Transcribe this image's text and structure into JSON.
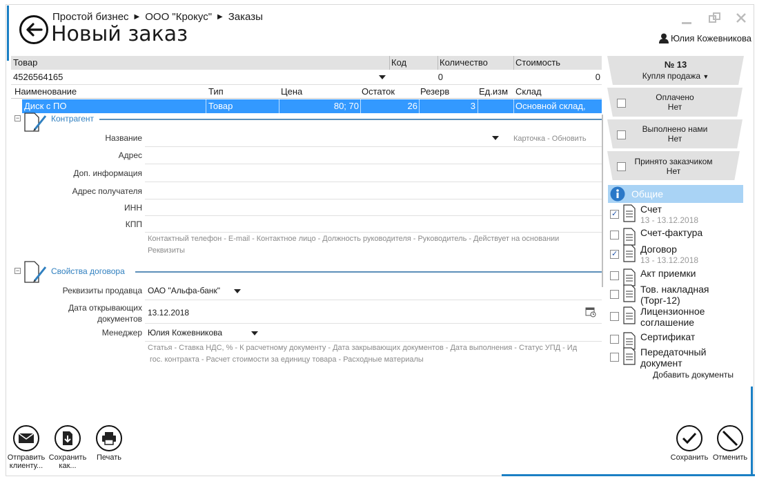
{
  "breadcrumb": [
    "Простой бизнес",
    "ООО \"Крокус\"",
    "Заказы"
  ],
  "title": "Новый заказ",
  "user": "Юлия Кожевникова",
  "goods_grid": {
    "headers": {
      "product": "Товар",
      "code": "Код",
      "qty": "Количество",
      "cost": "Стоимость"
    },
    "input": {
      "product": "4526564165",
      "qty": "0",
      "cost": "0"
    },
    "sub_headers": [
      "Наименование",
      "Тип",
      "Цена",
      "Остаток",
      "Резерв",
      "Ед.изм",
      "Склад"
    ],
    "selected_row": {
      "name": "Диск с ПО",
      "type": "Товар",
      "price": "80; 70",
      "stock": "26",
      "reserve": "3",
      "unit": "",
      "warehouse": "Основной склад,"
    }
  },
  "counterparty": {
    "section_title": "Контрагент",
    "labels": [
      "Название",
      "Адрес",
      "Доп. информация",
      "Адрес получателя",
      "ИНН",
      "КПП"
    ],
    "card_link": "Карточка",
    "refresh_link": "Обновить",
    "extra_links_1": [
      "Контактный телефон",
      "E-mail",
      "Контактное лицо",
      "Должность руководителя",
      "Руководитель",
      "Действует на основании"
    ],
    "extra_links_2": [
      "Реквизиты"
    ]
  },
  "contract": {
    "section_title": "Свойства договора",
    "seller_label": "Реквизиты продавца",
    "seller_value": "ОАО \"Альфа-банк\"",
    "date_label_1": "Дата открывающих",
    "date_label_2": "документов",
    "date_value": "13.12.2018",
    "manager_label": "Менеджер",
    "manager_value": "Юлия Кожевникова",
    "extra_links_1": [
      "Статья",
      "Ставка НДС, %",
      "К расчетному документу",
      "Дата закрывающих документов",
      "Дата выполнения",
      "Статус УПД",
      "Ид"
    ],
    "extra_links_2": [
      "гос. контракта",
      "Расчет стоимости за единицу товара",
      "Расходные материалы"
    ]
  },
  "order_panel": {
    "number": "№ 13",
    "type": "Купля продажа",
    "paid_label": "Оплачено",
    "paid_value": "Нет",
    "done_label": "Выполнено нами",
    "done_value": "Нет",
    "accepted_label": "Принято заказчиком",
    "accepted_value": "Нет"
  },
  "documents": {
    "header": "Общие",
    "items": [
      {
        "label": "Счет",
        "sub": "13 - 13.12.2018",
        "checked": true
      },
      {
        "label": "Счет-фактура",
        "sub": "",
        "checked": false
      },
      {
        "label": "Договор",
        "sub": "13 - 13.12.2018",
        "checked": true
      },
      {
        "label": "Акт приемки",
        "sub": "",
        "checked": false
      },
      {
        "label": "Тов. накладная",
        "sub": "(Торг-12)",
        "checked": false
      },
      {
        "label": "Лицензионное",
        "sub": "соглашение",
        "checked": false
      },
      {
        "label": "Сертификат",
        "sub": "",
        "checked": false
      },
      {
        "label": "Передаточный",
        "sub": "документ",
        "checked": false
      }
    ],
    "add_link": "Добавить документы"
  },
  "bottom": {
    "send_1": "Отправить",
    "send_2": "клиенту...",
    "save_as_1": "Сохранить",
    "save_as_2": "как...",
    "print": "Печать",
    "save": "Сохранить",
    "cancel": "Отменить"
  }
}
